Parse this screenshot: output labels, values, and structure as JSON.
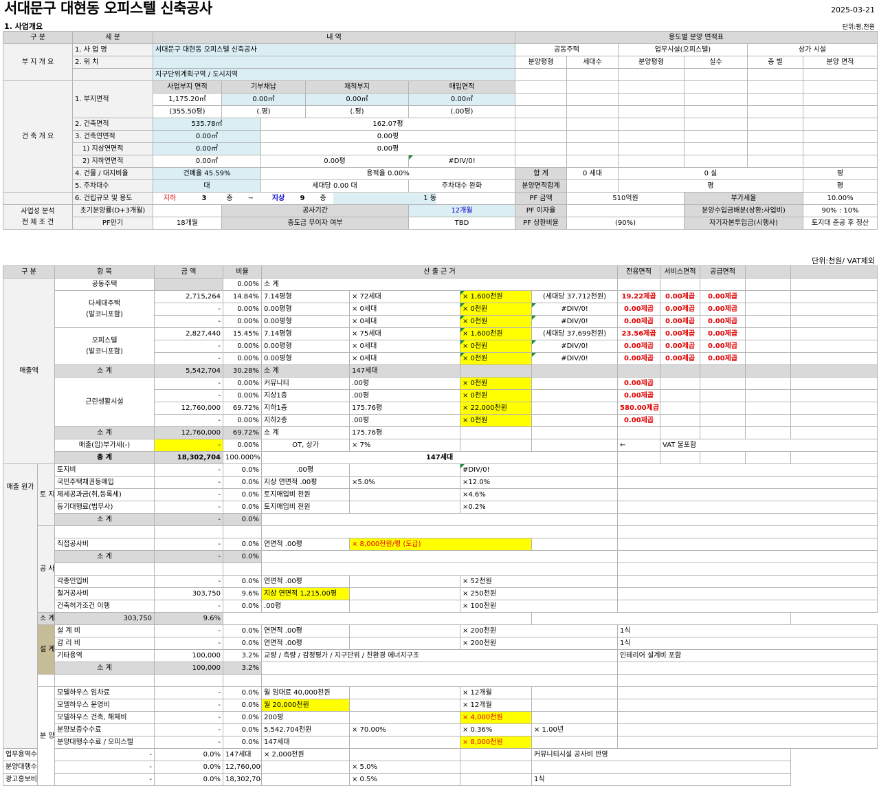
{
  "header": {
    "title": "서대문구 대현동 오피스텔 신축공사",
    "date": "2025-03-21",
    "section": "1. 사업개요",
    "unit1": "단위:평,천원",
    "unit2": "단위:천원/ VAT제외"
  },
  "t1": {
    "h_gubun": "구 분",
    "h_sebun": "세 분",
    "h_naeyeok": "내 역",
    "h_yongdo": "용도별 분양 면적표",
    "buji": "부 지 개 요",
    "saeop_label": "1. 사 업 명",
    "saeop_val": "서대문구 대현동 오피스텔 신축공사",
    "wichi_label": "2. 위 치",
    "jigu": "지구단위계획구역 / 도시지역",
    "gongdong": "공동주택",
    "eomu": "업무시설(오피스텔)",
    "sangga": "상가 시설",
    "bunyang_py": "분양평형",
    "sedaesu": "세대수",
    "silsu": "실수",
    "cheungbyeol": "층 별",
    "bunyang_myeon": "분양 면적",
    "geonchuk": "건 축 개 요",
    "bujimyeon": "1. 부지면적",
    "c_saeopbuji": "사업부지 면적",
    "c_gibu": "기부채납",
    "c_jejeok": "제척부지",
    "c_maeip": "매입면적",
    "v_saeopbuji": "1,175.20㎡",
    "v_gibu": "0.00㎡",
    "v_jejeok": "0.00㎡",
    "v_maeip": "0.00㎡",
    "p_saeopbuji": "(355.50평)",
    "p_gibu": "(.평)",
    "p_jejeok": "(.평)",
    "p_maeip": "(.00평)",
    "gc_label": "2. 건축면적",
    "gc_m2": "535.78㎡",
    "gc_py": "162.07평",
    "gy_label": "3. 건축연면적",
    "gy_m2": "0.00㎡",
    "gy_py": "0.00평",
    "js_label": "1) 지상연면적",
    "js_m2": "0.00㎡",
    "js_py": "0.00평",
    "jh_label": "2) 지하연면적",
    "jh_m2": "0.00㎡",
    "jh_py": "0.00평",
    "jh_div": "#DIV/0!",
    "gd_label": "4. 건물 / 대지비율",
    "gd_gp": "건폐율 45.59%",
    "gd_yj": "용적율 0.00%",
    "hapgye": "합 계",
    "hap_sedae": "0 세대",
    "hap_sil": "0 실",
    "hap_py": "평",
    "ju_label": "5. 주차대수",
    "ju_dae": "대",
    "ju_sedae": "세대당 0.00 대",
    "ju_wan": "주차대수 완화",
    "bun_hap": "분양면적합계",
    "bun_py1": "평",
    "bun_py2": "평",
    "gj_label": "6. 건립규모 및 용도",
    "jiha": "지하",
    "jiha_n": "3",
    "cheung": "층",
    "tilde": "~",
    "jisang": "지상",
    "jisang_n": "9",
    "dong": "1 동",
    "pf_geum": "PF 금액",
    "pf_geum_v": "510억원",
    "bugase": "부가세율",
    "bugase_v": "10.00%",
    "saeop_bunseok": "사업성 분석",
    "jeonje": "전 제 조 건",
    "chogi": "초기분양률(D+3개월)",
    "gongsa": "공사기간",
    "gongsa_v": "12개월",
    "pf_ija": "PF 이자율",
    "bunsu": "분양수입금배분(상환:사업비)",
    "bunsu_v": "90% : 10%",
    "pf_man": "PF만기",
    "pf_man_v": "18개월",
    "jungdo": "중도금 무이자 여부",
    "jungdo_v": "TBD",
    "pf_sang": "PF 상환비율",
    "pf_sang_v": "(90%)",
    "jagi": "자기자본투입금(시행사)",
    "jagi_v": "토지대 준공 후 정산"
  },
  "t2": {
    "h": {
      "gubun": "구 분",
      "hangmok": "항 목",
      "geumaek": "금 액",
      "biyul": "비율",
      "sanchul": "산 출 근 거",
      "jeonyong": "전용면적",
      "service": "서비스면적",
      "gonggeup": "공급면적"
    },
    "maechul": "매출액",
    "gongdong": "공동주택",
    "gongdong_b": "0.00%",
    "sogye": "소 계",
    "dase": "다세대주택",
    "balkoni": "(발코니포함)",
    "officetel": "오피스텔",
    "geunrin": "근린생활시설",
    "r_dase": [
      {
        "a": "2,715,264",
        "b": "14.84%",
        "c": "7.14평형",
        "d": "× 72세대",
        "e": "× 1,600천원",
        "f": "(세대당 37,712천원)",
        "g": "19.22제곱",
        "h": "0.00제곱",
        "i": "0.00제곱"
      },
      {
        "a": "-",
        "b": "0.00%",
        "c": "0.00평형",
        "d": "× 0세대",
        "e": "× 0천원",
        "f": "#DIV/0!",
        "g": "0.00제곱",
        "h": "0.00제곱",
        "i": "0.00제곱"
      },
      {
        "a": "-",
        "b": "0.00%",
        "c": "0.00평형",
        "d": "× 0세대",
        "e": "× 0천원",
        "f": "#DIV/0!",
        "g": "0.00제곱",
        "h": "0.00제곱",
        "i": "0.00제곱"
      }
    ],
    "r_off": [
      {
        "a": "2,827,440",
        "b": "15.45%",
        "c": "7.14평형",
        "d": "× 75세대",
        "e": "× 1,600천원",
        "f": "(세대당 37,699천원)",
        "g": "23.56제곱",
        "h": "0.00제곱",
        "i": "0.00제곱"
      },
      {
        "a": "-",
        "b": "0.00%",
        "c": "0.00평형",
        "d": "× 0세대",
        "e": "× 0천원",
        "f": "#DIV/0!",
        "g": "0.00제곱",
        "h": "0.00제곱",
        "i": "0.00제곱"
      },
      {
        "a": "-",
        "b": "0.00%",
        "c": "0.00평형",
        "d": "× 0세대",
        "e": "× 0천원",
        "f": "#DIV/0!",
        "g": "0.00제곱",
        "h": "0.00제곱",
        "i": "0.00제곱"
      }
    ],
    "s1": {
      "a": "5,542,704",
      "b": "30.28%",
      "c": "147세대"
    },
    "r_gr": [
      {
        "a": "-",
        "b": "0.00%",
        "c": "커뮤니티",
        "d": ".00평",
        "e": "× 0천원",
        "g": "0.00제곱"
      },
      {
        "a": "-",
        "b": "0.00%",
        "c": "지상1층",
        "d": ".00평",
        "e": "× 0천원",
        "g": "0.00제곱"
      },
      {
        "a": "12,760,000",
        "b": "69.72%",
        "c": "지하1층",
        "d": "175.76평",
        "e": "× 22,000천원",
        "g": "580.00제곱"
      },
      {
        "a": "-",
        "b": "0.00%",
        "c": "지하2층",
        "d": ".00평",
        "e": "× 0천원",
        "g": "0.00제곱"
      }
    ],
    "s2": {
      "a": "12,760,000",
      "b": "69.72%",
      "d": "175.76평"
    },
    "vat": {
      "label": "매출(입)부가세(-)",
      "a": "-",
      "b": "0.00%",
      "c": "OT, 상가",
      "d": "× 7%",
      "f": "←",
      "g": "VAT 불포함"
    },
    "total": {
      "label": "총 계",
      "a": "18,302,704",
      "b": "100.000%",
      "c": "147세대"
    },
    "wonga": "매출 원가",
    "toji": "토 지 비 등",
    "gongsabi": "공 사 비",
    "seolgye": "설 계 감 리 비",
    "bunyang": "분 양 경 비",
    "rows_toji": [
      {
        "n": "토지비",
        "a": "-",
        "b": "0.0%",
        "c": ".00평",
        "e": "#DIV/0!"
      },
      {
        "n": "국민주택채권등매입",
        "a": "-",
        "b": "0.0%",
        "c": "지상 연면적 .00평",
        "d": "×5.0%",
        "e": "×12.0%"
      },
      {
        "n": "제세공과금(취,등록세)",
        "a": "-",
        "b": "0.0%",
        "c": "토지매입비 천원",
        "e": "×4.6%"
      },
      {
        "n": "등기대행료(법무사)",
        "a": "-",
        "b": "0.0%",
        "c": "토지매입비 천원",
        "e": "×0.2%"
      }
    ],
    "s_toji": {
      "a": "-",
      "b": "0.0%"
    },
    "jikjeop": {
      "n": "직접공사비",
      "a": "-",
      "b": "0.0%",
      "c": "연면적 .00평",
      "d": "× 8,000천원/평 (도급)"
    },
    "s_jik": {
      "a": "-",
      "b": "0.0%"
    },
    "rows_gong": [
      {
        "n": "각종인입비",
        "a": "-",
        "b": "0.0%",
        "c": "연면적 .00평",
        "e": "× 52천원"
      },
      {
        "n": "철거공사비",
        "a": "303,750",
        "b": "9.6%",
        "c": "지상 연면적 1,215.00평",
        "e": "× 250천원"
      },
      {
        "n": "건축허가조건 이행",
        "a": "-",
        "b": "0.0%",
        "c": ".00평",
        "e": "× 100천원"
      }
    ],
    "s_gong": {
      "a": "303,750",
      "b": "9.6%"
    },
    "rows_seol": [
      {
        "n": "설 계 비",
        "a": "-",
        "b": "0.0%",
        "c": "연면적 .00평",
        "e": "× 200천원",
        "g": "1식"
      },
      {
        "n": "감 리 비",
        "a": "-",
        "b": "0.0%",
        "c": "연면적 .00평",
        "e": "× 200천원",
        "g": "1식"
      },
      {
        "n": "기타용역",
        "a": "100,000",
        "b": "3.2%",
        "c": "교량 / 측량 / 감정평가 / 지구단위 / 친환경 에너지구조",
        "g": "인테리어 설계비 포함"
      }
    ],
    "s_seol": {
      "a": "100,000",
      "b": "3.2%"
    },
    "rows_bun": [
      {
        "n": "모델하우스 임차료",
        "a": "-",
        "b": "0.0%",
        "c": "월 임대료 40,000천원",
        "e": "× 12개월"
      },
      {
        "n": "모델하우스 운영비",
        "a": "-",
        "b": "0.0%",
        "c": "월 20,000천원",
        "e": "× 12개월"
      },
      {
        "n": "모델하우스 건축, 해체비",
        "a": "-",
        "b": "0.0%",
        "c": "200평",
        "e": "× 4,000천원"
      },
      {
        "n": "분양보증수수료",
        "a": "-",
        "b": "0.0%",
        "c": "5,542,704천원",
        "d": "× 70.00%",
        "e": "× 0.36%",
        "f": "× 1.00년"
      },
      {
        "n": "분양대행수수료 / 오피스텔",
        "a": "-",
        "b": "0.0%",
        "c": "147세대",
        "e": "× 8,000천원"
      },
      {
        "n": "업무용역수수료",
        "a": "-",
        "b": "0.0%",
        "c": "147세대",
        "d": "× 2,000천원",
        "g": "커뮤니티시설 공사비 반영"
      },
      {
        "n": "분양대행수수료 / 상가 추가",
        "a": "-",
        "b": "0.0%",
        "c": "12,760,000",
        "e": "× 5.0%"
      },
      {
        "n": "광고홍보비",
        "a": "-",
        "b": "0.0%",
        "c": "18,302,704천원",
        "e": "× 0.5%",
        "g": "1식"
      }
    ]
  }
}
